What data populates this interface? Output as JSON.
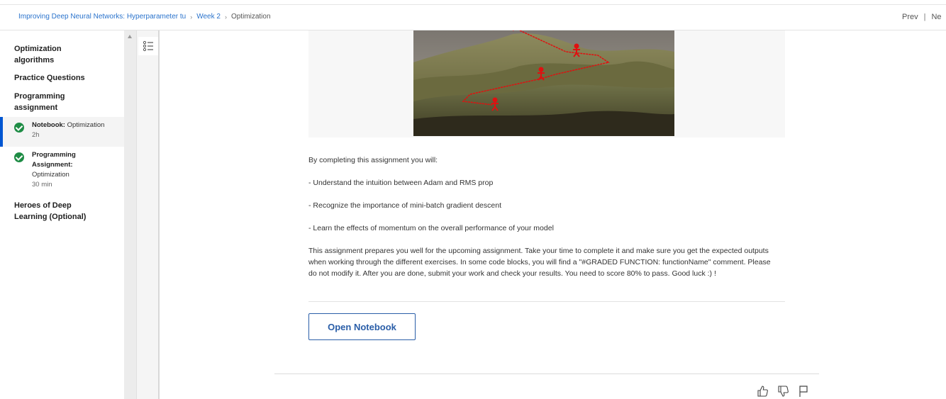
{
  "breadcrumb": {
    "course": "Improving Deep Neural Networks: Hyperparameter tu",
    "week": "Week 2",
    "current": "Optimization"
  },
  "nav": {
    "prev": "Prev",
    "next": "Ne"
  },
  "sidebar": {
    "sections": [
      {
        "label": "Optimization algorithms"
      },
      {
        "label": "Practice Questions"
      },
      {
        "label": "Programming assignment"
      }
    ],
    "items": [
      {
        "type": "Notebook:",
        "title": "Optimization",
        "duration": "2h",
        "completed": true,
        "active": true
      },
      {
        "type": "Programming Assignment:",
        "title": "Optimization",
        "duration": "30 min",
        "completed": true,
        "active": false
      }
    ],
    "after_section": {
      "label": "Heroes of Deep Learning (Optional)"
    }
  },
  "content": {
    "intro": "By completing this assignment you will:",
    "bullets": [
      "- Understand the intuition between Adam and RMS prop",
      "- Recognize the importance of mini-batch gradient descent",
      "- Learn the effects of momentum on the overall performance of your model"
    ],
    "paragraph": "This assignment prepares you well for the upcoming assignment. Take your time to complete it and make sure you get the expected outputs when working through the different exercises. In some code blocks, you will find a \"#GRADED FUNCTION: functionName\" comment. Please do not modify it. After you are done, submit your work and check your results. You need to score 80% to pass. Good luck :) !",
    "open_button": "Open Notebook"
  },
  "colors": {
    "accent": "#0056d2",
    "link": "#2a73cc",
    "success": "#1e8c45",
    "button_border": "#2a5ea8"
  }
}
